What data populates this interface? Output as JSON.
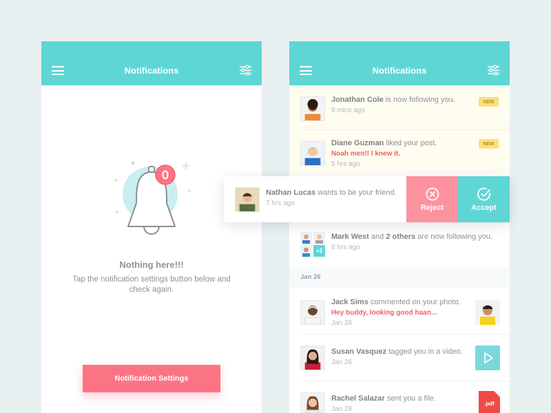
{
  "left": {
    "header": {
      "title": "Notifications"
    },
    "empty": {
      "title": "Nothing here!!!",
      "text": "Tap the notification settings button below and check again."
    },
    "settings_button": "Notification Settings"
  },
  "right": {
    "header": {
      "title": "Notifications"
    },
    "items": [
      {
        "name": "Jonathan Cole",
        "action": "is now following you.",
        "time": "8 mins ago",
        "badge": "NEW"
      },
      {
        "name": "Diane Guzman",
        "action": "liked your post.",
        "quote": "Noah men!! I knew it.",
        "time": "5 hrs ago",
        "badge": "NEW"
      },
      {
        "name": "Mark West",
        "mid": "and",
        "others": "2 others",
        "action": "are now following you.",
        "time": "8 hrs ago",
        "extra": "+2"
      },
      {
        "name": "Jack Sims",
        "action": "commented on your photo.",
        "quote": "Hey buddy, looking good haan...",
        "time": "Jan 26"
      },
      {
        "name": "Susan Vasquez",
        "action": "tagged you in a video.",
        "time": "Jan 26"
      },
      {
        "name": "Rachel Salazar",
        "action": "sent you a file.",
        "time": "Jan 26",
        "file": ".pdf"
      }
    ],
    "date_header": "Jan 26",
    "swipe": {
      "name": "Nathan Lucas",
      "action": "wants to be your friend.",
      "time": "7 hrs ago",
      "reject": "Reject",
      "accept": "Accept"
    }
  },
  "colors": {
    "accent": "#5fd6d6",
    "pink": "#fb7486",
    "new_badge": "#fbe07b"
  },
  "icons": [
    "menu-icon",
    "filter-icon",
    "bell-icon",
    "reject-icon",
    "accept-icon",
    "play-icon"
  ]
}
